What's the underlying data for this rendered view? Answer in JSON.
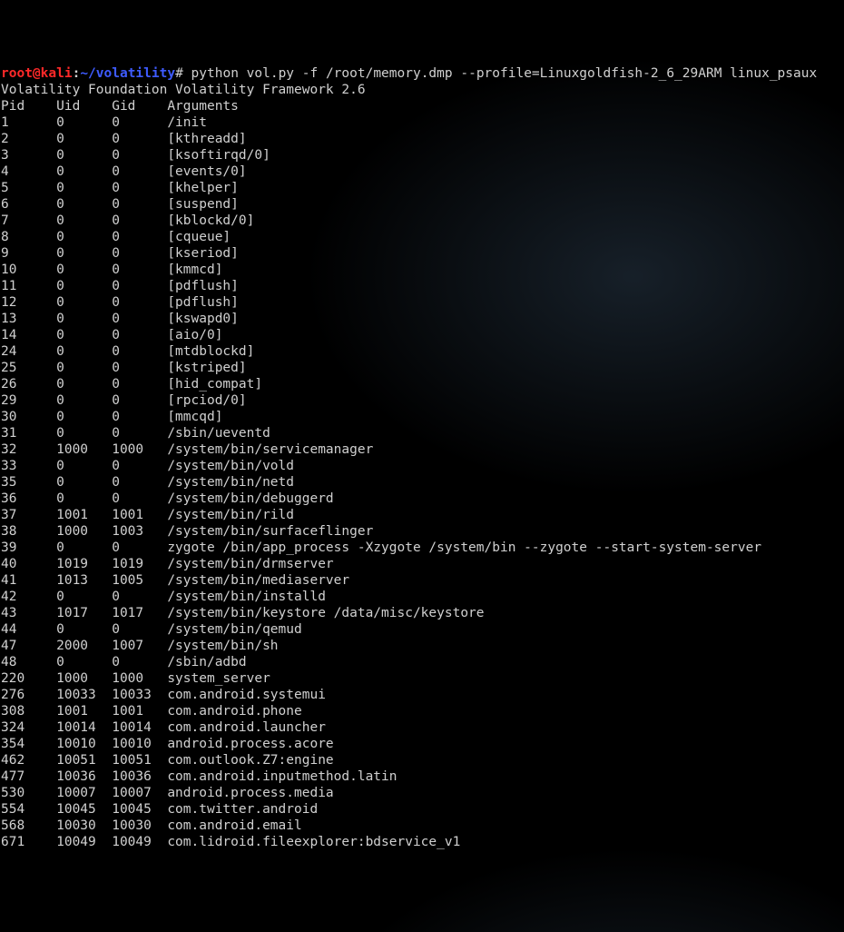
{
  "prompt": {
    "user": "root@kali",
    "sep1": ":",
    "path": "~/volatility",
    "hash": "#",
    "command": " python vol.py -f /root/memory.dmp --profile=Linuxgoldfish-2_6_29ARM linux_psaux"
  },
  "banner": "Volatility Foundation Volatility Framework 2.6",
  "header": {
    "pid": "Pid",
    "uid": "Uid",
    "gid": "Gid",
    "args": "Arguments"
  },
  "processes": [
    {
      "pid": "1",
      "uid": "0",
      "gid": "0",
      "args": "/init"
    },
    {
      "pid": "2",
      "uid": "0",
      "gid": "0",
      "args": "[kthreadd]"
    },
    {
      "pid": "3",
      "uid": "0",
      "gid": "0",
      "args": "[ksoftirqd/0]"
    },
    {
      "pid": "4",
      "uid": "0",
      "gid": "0",
      "args": "[events/0]"
    },
    {
      "pid": "5",
      "uid": "0",
      "gid": "0",
      "args": "[khelper]"
    },
    {
      "pid": "6",
      "uid": "0",
      "gid": "0",
      "args": "[suspend]"
    },
    {
      "pid": "7",
      "uid": "0",
      "gid": "0",
      "args": "[kblockd/0]"
    },
    {
      "pid": "8",
      "uid": "0",
      "gid": "0",
      "args": "[cqueue]"
    },
    {
      "pid": "9",
      "uid": "0",
      "gid": "0",
      "args": "[kseriod]"
    },
    {
      "pid": "10",
      "uid": "0",
      "gid": "0",
      "args": "[kmmcd]"
    },
    {
      "pid": "11",
      "uid": "0",
      "gid": "0",
      "args": "[pdflush]"
    },
    {
      "pid": "12",
      "uid": "0",
      "gid": "0",
      "args": "[pdflush]"
    },
    {
      "pid": "13",
      "uid": "0",
      "gid": "0",
      "args": "[kswapd0]"
    },
    {
      "pid": "14",
      "uid": "0",
      "gid": "0",
      "args": "[aio/0]"
    },
    {
      "pid": "24",
      "uid": "0",
      "gid": "0",
      "args": "[mtdblockd]"
    },
    {
      "pid": "25",
      "uid": "0",
      "gid": "0",
      "args": "[kstriped]"
    },
    {
      "pid": "26",
      "uid": "0",
      "gid": "0",
      "args": "[hid_compat]"
    },
    {
      "pid": "29",
      "uid": "0",
      "gid": "0",
      "args": "[rpciod/0]"
    },
    {
      "pid": "30",
      "uid": "0",
      "gid": "0",
      "args": "[mmcqd]"
    },
    {
      "pid": "31",
      "uid": "0",
      "gid": "0",
      "args": "/sbin/ueventd"
    },
    {
      "pid": "32",
      "uid": "1000",
      "gid": "1000",
      "args": "/system/bin/servicemanager"
    },
    {
      "pid": "33",
      "uid": "0",
      "gid": "0",
      "args": "/system/bin/vold"
    },
    {
      "pid": "35",
      "uid": "0",
      "gid": "0",
      "args": "/system/bin/netd"
    },
    {
      "pid": "36",
      "uid": "0",
      "gid": "0",
      "args": "/system/bin/debuggerd"
    },
    {
      "pid": "37",
      "uid": "1001",
      "gid": "1001",
      "args": "/system/bin/rild"
    },
    {
      "pid": "38",
      "uid": "1000",
      "gid": "1003",
      "args": "/system/bin/surfaceflinger"
    },
    {
      "pid": "39",
      "uid": "0",
      "gid": "0",
      "args": "zygote /bin/app_process -Xzygote /system/bin --zygote --start-system-server"
    },
    {
      "pid": "40",
      "uid": "1019",
      "gid": "1019",
      "args": "/system/bin/drmserver"
    },
    {
      "pid": "41",
      "uid": "1013",
      "gid": "1005",
      "args": "/system/bin/mediaserver"
    },
    {
      "pid": "42",
      "uid": "0",
      "gid": "0",
      "args": "/system/bin/installd"
    },
    {
      "pid": "43",
      "uid": "1017",
      "gid": "1017",
      "args": "/system/bin/keystore /data/misc/keystore"
    },
    {
      "pid": "44",
      "uid": "0",
      "gid": "0",
      "args": "/system/bin/qemud"
    },
    {
      "pid": "47",
      "uid": "2000",
      "gid": "1007",
      "args": "/system/bin/sh"
    },
    {
      "pid": "48",
      "uid": "0",
      "gid": "0",
      "args": "/sbin/adbd"
    },
    {
      "pid": "220",
      "uid": "1000",
      "gid": "1000",
      "args": "system_server"
    },
    {
      "pid": "276",
      "uid": "10033",
      "gid": "10033",
      "args": "com.android.systemui"
    },
    {
      "pid": "308",
      "uid": "1001",
      "gid": "1001",
      "args": "com.android.phone"
    },
    {
      "pid": "324",
      "uid": "10014",
      "gid": "10014",
      "args": "com.android.launcher"
    },
    {
      "pid": "354",
      "uid": "10010",
      "gid": "10010",
      "args": "android.process.acore"
    },
    {
      "pid": "462",
      "uid": "10051",
      "gid": "10051",
      "args": "com.outlook.Z7:engine"
    },
    {
      "pid": "477",
      "uid": "10036",
      "gid": "10036",
      "args": "com.android.inputmethod.latin"
    },
    {
      "pid": "530",
      "uid": "10007",
      "gid": "10007",
      "args": "android.process.media"
    },
    {
      "pid": "554",
      "uid": "10045",
      "gid": "10045",
      "args": "com.twitter.android"
    },
    {
      "pid": "568",
      "uid": "10030",
      "gid": "10030",
      "args": "com.android.email"
    },
    {
      "pid": "671",
      "uid": "10049",
      "gid": "10049",
      "args": "com.lidroid.fileexplorer:bdservice_v1"
    }
  ]
}
